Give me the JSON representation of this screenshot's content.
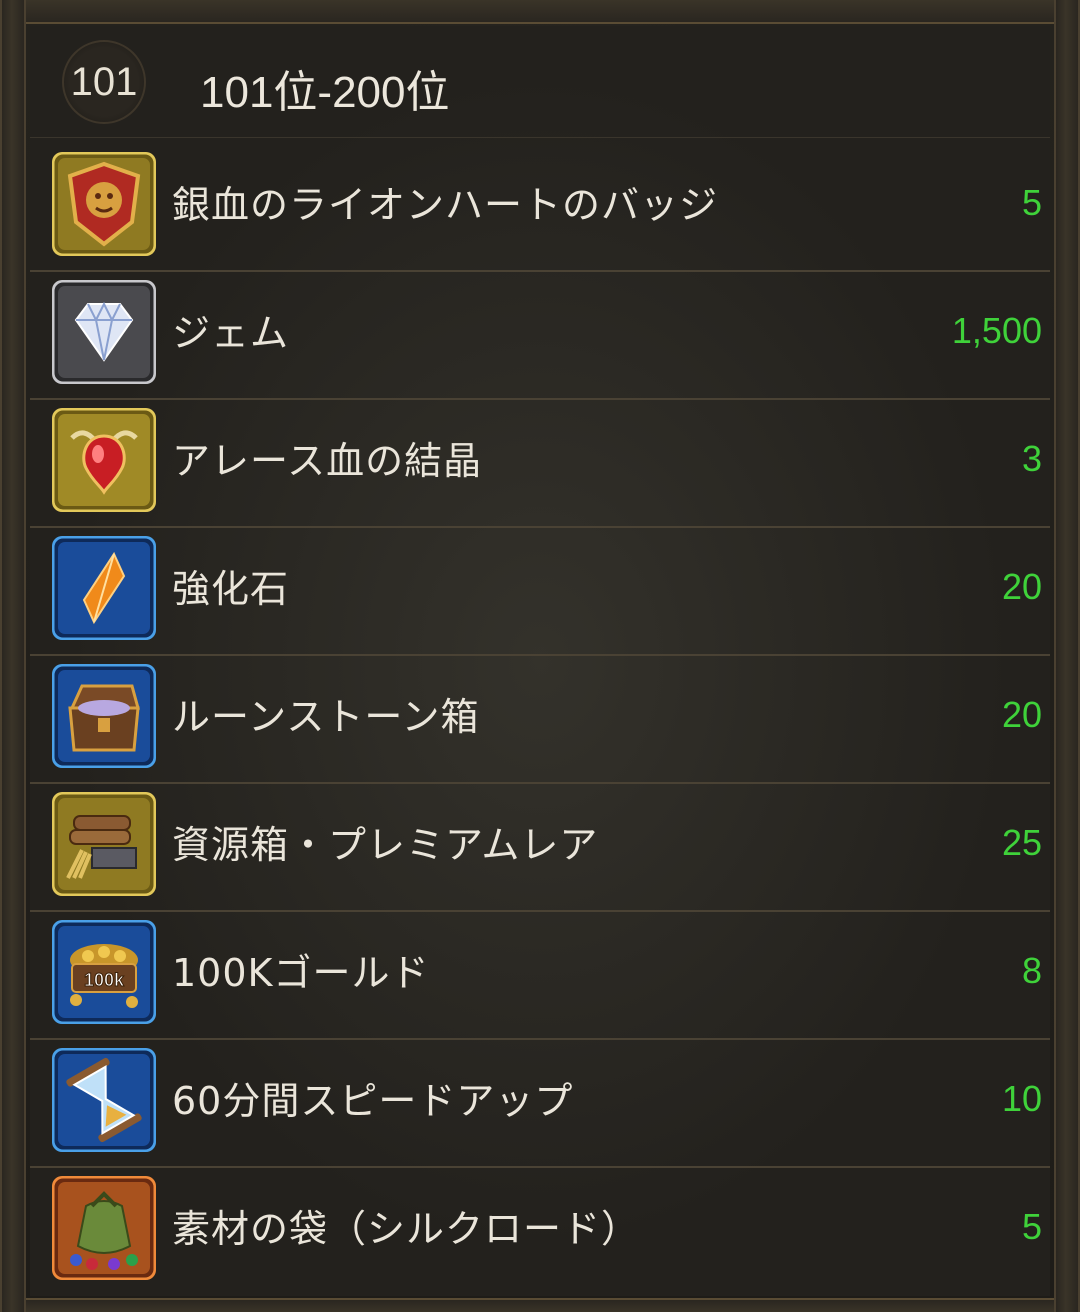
{
  "header": {
    "rank_badge": "101",
    "title": "101位-200位"
  },
  "rewards": [
    {
      "label": "銀血のライオンハートのバッジ",
      "qty": "5",
      "icon": "lion-badge-icon"
    },
    {
      "label": "ジェム",
      "qty": "1,500",
      "icon": "gem-icon"
    },
    {
      "label": "アレース血の結晶",
      "qty": "3",
      "icon": "blood-crystal-icon"
    },
    {
      "label": "強化石",
      "qty": "20",
      "icon": "enhancement-stone-icon"
    },
    {
      "label": "ルーンストーン箱",
      "qty": "20",
      "icon": "runestone-chest-icon"
    },
    {
      "label": "資源箱・プレミアムレア",
      "qty": "25",
      "icon": "resource-box-icon"
    },
    {
      "label": "100Kゴールド",
      "qty": "8",
      "icon": "gold-pile-icon",
      "icon_text": "100k"
    },
    {
      "label": "60分間スピードアップ",
      "qty": "10",
      "icon": "hourglass-icon"
    },
    {
      "label": "素材の袋（シルクロード）",
      "qty": "5",
      "icon": "material-bag-icon"
    }
  ],
  "colors": {
    "qty": "#3fd23a",
    "text": "#eae5da",
    "divider": "#4a4234"
  }
}
